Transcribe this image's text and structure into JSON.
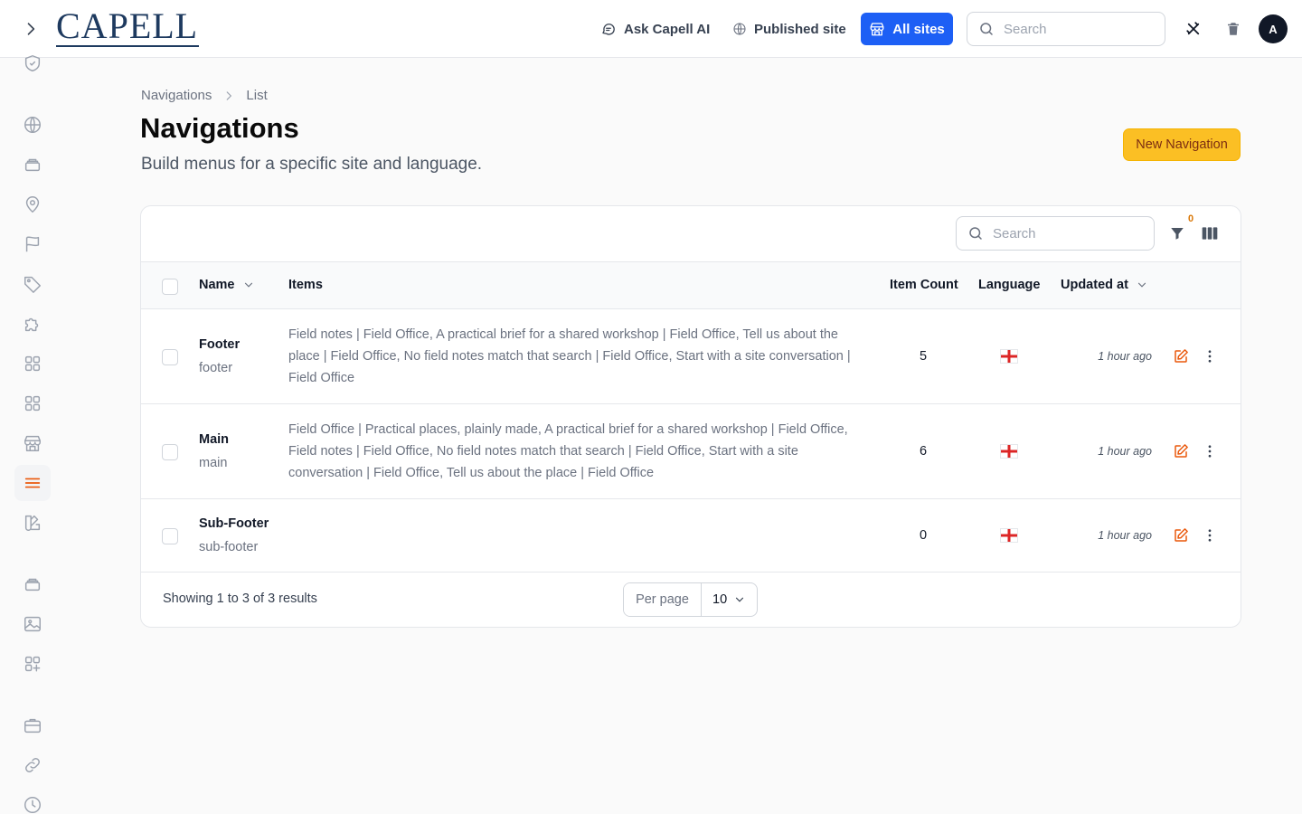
{
  "header": {
    "logo_text": "CAPELL",
    "ask_ai_label": "Ask Capell AI",
    "published_site_label": "Published site",
    "all_sites_label": "All sites",
    "search_placeholder": "Search",
    "avatar_initial": "A"
  },
  "sidebar": {
    "icons": [
      "shield-check-icon",
      "globe-icon",
      "layers-icon",
      "map-pin-icon",
      "flag-icon",
      "tag-icon",
      "puzzle-icon",
      "grid-icon",
      "grid-icon",
      "storefront-icon",
      "menu-icon",
      "swatch-icon",
      "layers-icon",
      "image-icon",
      "grid-plus-icon",
      "briefcase-icon",
      "link-icon",
      "clock-icon"
    ],
    "active_item": "menu-icon"
  },
  "breadcrumb": {
    "items": [
      "Navigations",
      "List"
    ]
  },
  "page": {
    "title": "Navigations",
    "subtitle": "Build menus for a specific site and language.",
    "new_button_label": "New Navigation"
  },
  "table": {
    "search_placeholder": "Search",
    "filter_count": "0",
    "columns": {
      "name": "Name",
      "items": "Items",
      "item_count": "Item Count",
      "language": "Language",
      "updated_at": "Updated at"
    },
    "rows": [
      {
        "name": "Footer",
        "slug": "footer",
        "items": "Field notes | Field Office, A practical brief for a shared workshop | Field Office, Tell us about the place | Field Office, No field notes match that search | Field Office, Start with a site conversation | Field Office",
        "item_count": "5",
        "language_flag": "england-flag-icon",
        "updated_at": "1 hour ago"
      },
      {
        "name": "Main",
        "slug": "main",
        "items": "Field Office | Practical places, plainly made, A practical brief for a shared workshop | Field Office, Field notes | Field Office, No field notes match that search | Field Office, Start with a site conversation | Field Office, Tell us about the place | Field Office",
        "item_count": "6",
        "language_flag": "england-flag-icon",
        "updated_at": "1 hour ago"
      },
      {
        "name": "Sub-Footer",
        "slug": "sub-footer",
        "items": "",
        "item_count": "0",
        "language_flag": "england-flag-icon",
        "updated_at": "1 hour ago"
      }
    ],
    "footer": {
      "results_text": "Showing 1 to 3 of 3 results",
      "per_page_label": "Per page",
      "per_page_value": "10"
    }
  },
  "colors": {
    "primary": "#1d5ff5",
    "accent": "#fbbf24",
    "active_nav": "#ea580c",
    "edit_icon": "#ea580c"
  }
}
